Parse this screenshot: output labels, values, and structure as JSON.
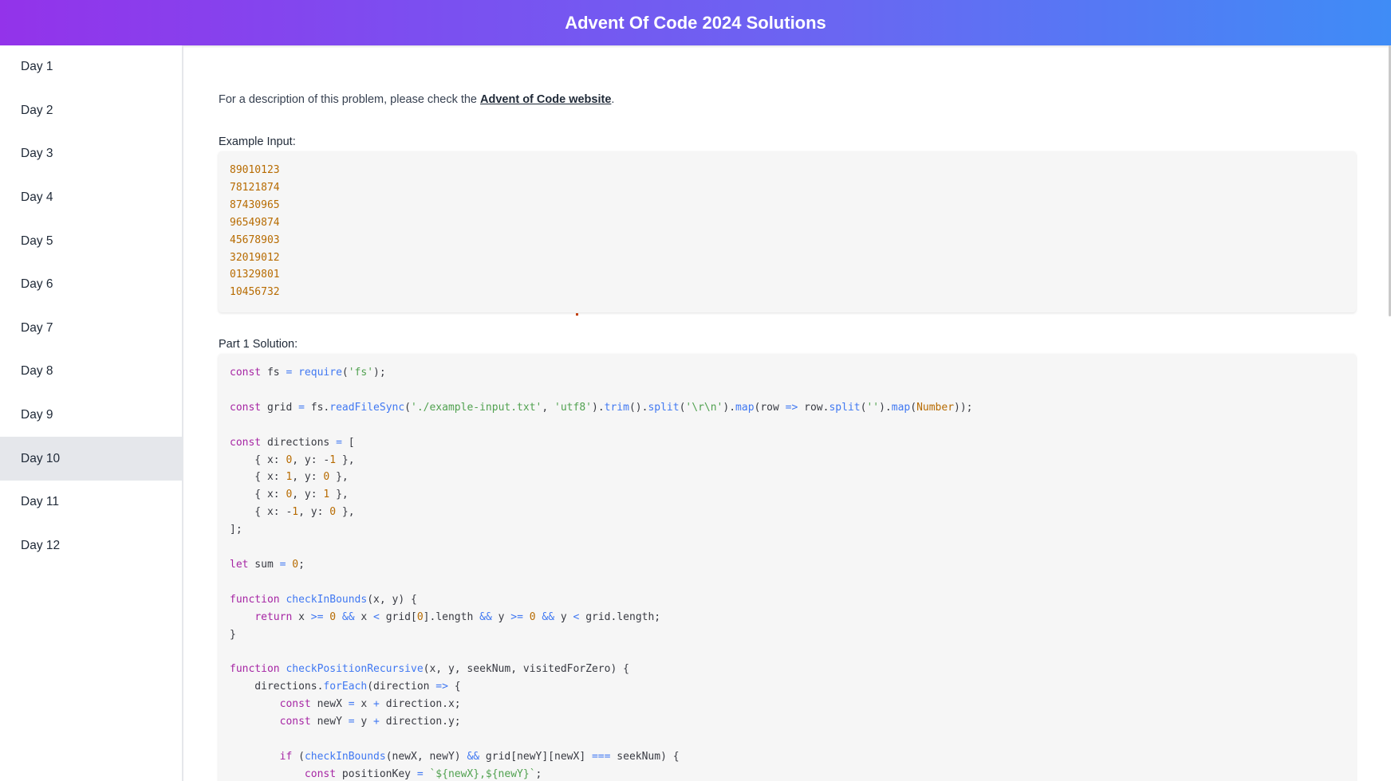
{
  "header": {
    "title": "Advent Of Code 2024 Solutions"
  },
  "sidebar": {
    "items": [
      {
        "label": "Day 1"
      },
      {
        "label": "Day 2"
      },
      {
        "label": "Day 3"
      },
      {
        "label": "Day 4"
      },
      {
        "label": "Day 5"
      },
      {
        "label": "Day 6"
      },
      {
        "label": "Day 7"
      },
      {
        "label": "Day 8"
      },
      {
        "label": "Day 9"
      },
      {
        "label": "Day 10"
      },
      {
        "label": "Day 11"
      },
      {
        "label": "Day 12"
      }
    ],
    "active_index": 9
  },
  "main": {
    "intro_prefix": "For a description of this problem, please check the ",
    "intro_link": "Advent of Code website",
    "intro_suffix": ".",
    "example_label": "Example Input:",
    "example_lines": [
      "89010123",
      "78121874",
      "87430965",
      "96549874",
      "45678903",
      "32019012",
      "01329801",
      "10456732"
    ],
    "part1_label": "Part 1 Solution:",
    "code_lines": [
      "const fs = require('fs');",
      "",
      "const grid = fs.readFileSync('./example-input.txt', 'utf8').trim().split('\\r\\n').map(row => row.split('').map(Number));",
      "",
      "const directions = [",
      "    { x: 0, y: -1 },",
      "    { x: 1, y: 0 },",
      "    { x: 0, y: 1 },",
      "    { x: -1, y: 0 },",
      "];",
      "",
      "let sum = 0;",
      "",
      "function checkInBounds(x, y) {",
      "    return x >= 0 && x < grid[0].length && y >= 0 && y < grid.length;",
      "}",
      "",
      "function checkPositionRecursive(x, y, seekNum, visitedForZero) {",
      "    directions.forEach(direction => {",
      "        const newX = x + direction.x;",
      "        const newY = y + direction.y;",
      "",
      "        if (checkInBounds(newX, newY) && grid[newY][newX] === seekNum) {",
      "            const positionKey = `${newX},${newY}`;"
    ]
  },
  "colors": {
    "header_gradient_start": "#9333ea",
    "header_gradient_end": "#3f8cf6",
    "active_item_bg": "#e5e7eb",
    "code_bg": "#f6f6f6"
  }
}
